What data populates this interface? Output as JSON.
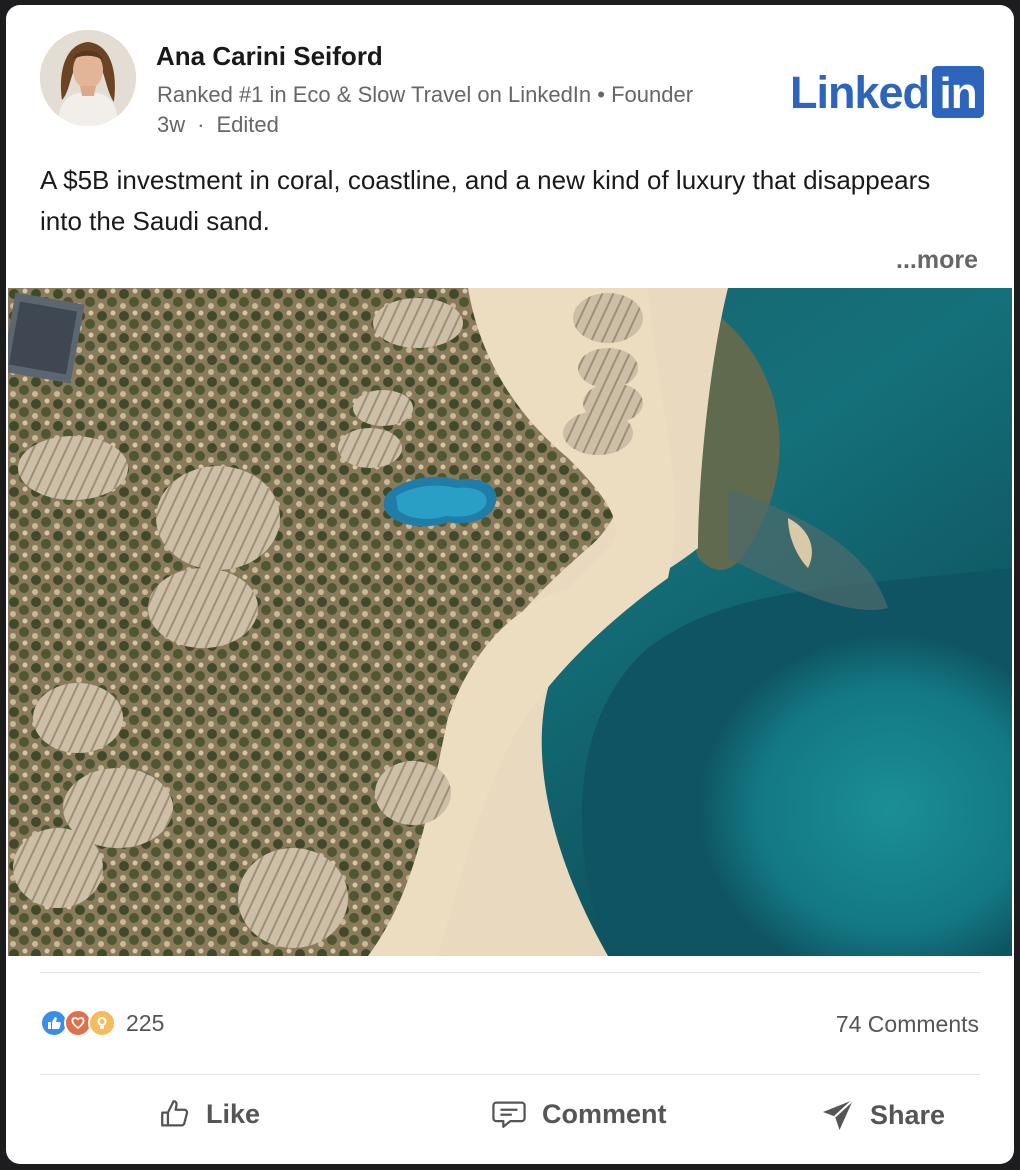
{
  "author": {
    "name": "Ana Carini Seiford",
    "headline": "Ranked #1 in Eco & Slow Travel on LinkedIn • Founder",
    "time": "3w",
    "separator": "·",
    "edited": "Edited"
  },
  "brand": {
    "logo_text": "Linked",
    "logo_box_text": "in",
    "color": "#2d64bc"
  },
  "post": {
    "text": "A $5B investment in coral, coastline, and a new kind of luxury that disappears into the Saudi sand.",
    "more_label": "...more",
    "image_icon": "aerial-photo"
  },
  "social": {
    "reaction_icons": [
      "like-icon",
      "love-icon",
      "insightful-icon"
    ],
    "reaction_count": "225",
    "comments_label": "74 Comments"
  },
  "actions": {
    "like_label": "Like",
    "comment_label": "Comment",
    "share_label": "Share"
  }
}
